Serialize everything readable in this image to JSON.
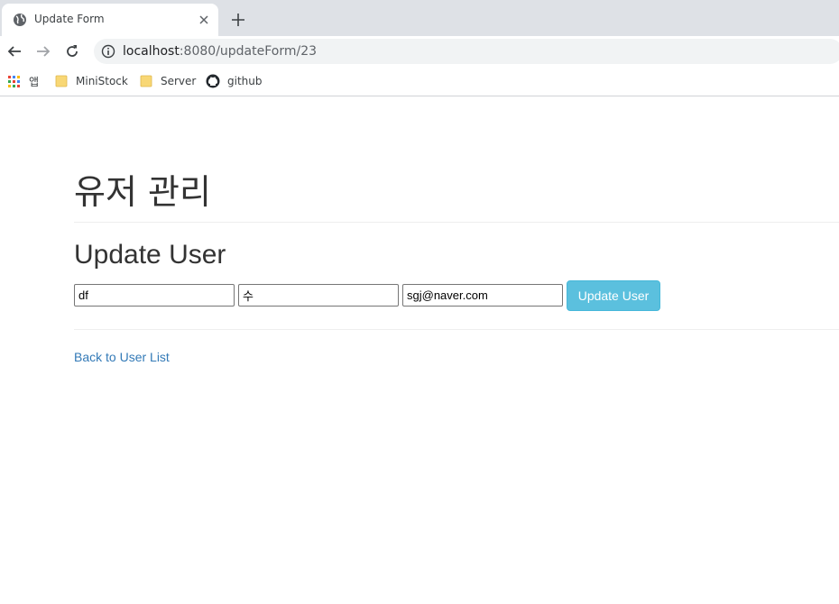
{
  "browser": {
    "tab": {
      "title": "Update Form"
    },
    "url": {
      "host": "localhost",
      "path": ":8080/updateForm/23"
    },
    "bookmarks": [
      {
        "label": "앱",
        "icon": "apps-grid-icon"
      },
      {
        "label": "MiniStock",
        "icon": "folder-icon"
      },
      {
        "label": "Server",
        "icon": "folder-icon"
      },
      {
        "label": "github",
        "icon": "github-icon"
      }
    ]
  },
  "page": {
    "heading": "유저 관리",
    "subheading": "Update User",
    "form": {
      "name_value": "df",
      "role_value": "수",
      "email_value": "sgj@naver.com",
      "submit_label": "Update User"
    },
    "back_link": "Back to User List"
  },
  "colors": {
    "primary_button": "#5bc0de",
    "link": "#337ab7",
    "tabstrip": "#dee1e6"
  }
}
